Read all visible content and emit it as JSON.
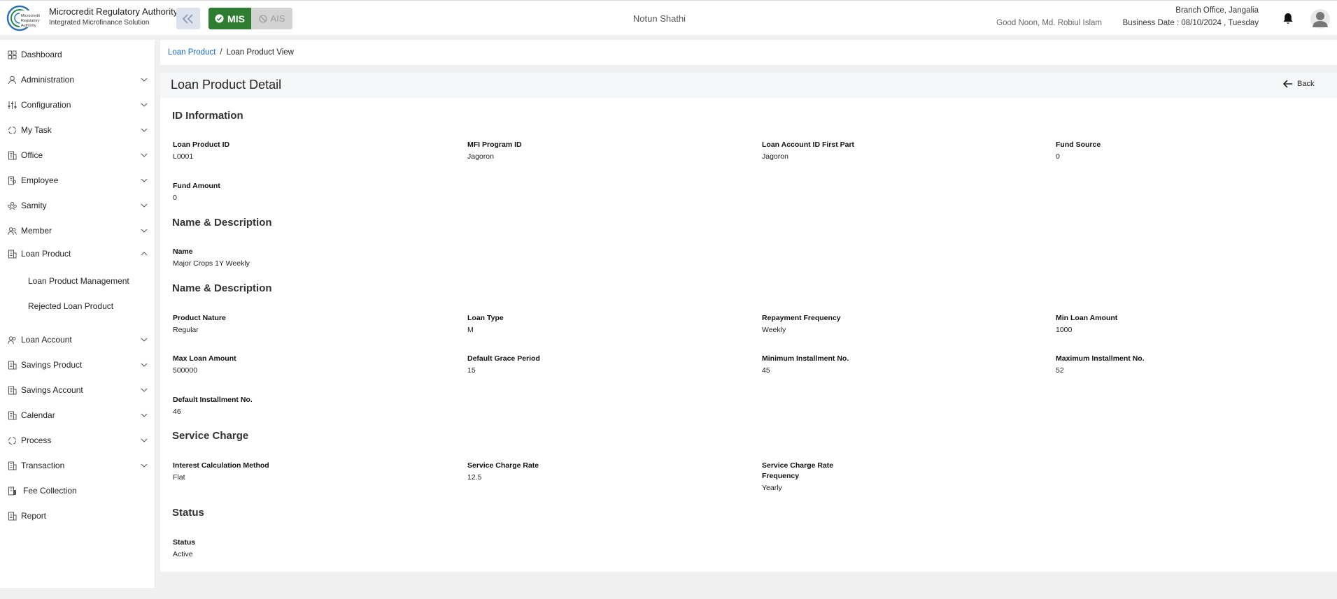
{
  "header": {
    "org_name": "Microcredit Regulatory Authority",
    "org_sub": "Integrated Microfinance Solution",
    "mode_mis": "MIS",
    "mode_ais": "AIS",
    "center_title": "Notun Shathi",
    "greeting": "Good Noon, Md. Robiul Islam",
    "branch": "Branch Office, Jangalia",
    "business_date": "Business Date : 08/10/2024 , Tuesday"
  },
  "sidebar": {
    "items": [
      {
        "label": "Dashboard",
        "icon": "dashboard-icon"
      },
      {
        "label": "Administration",
        "icon": "admin-icon"
      },
      {
        "label": "Configuration",
        "icon": "sliders-icon"
      },
      {
        "label": "My Task",
        "icon": "task-icon"
      },
      {
        "label": "Office",
        "icon": "office-icon"
      },
      {
        "label": "Employee",
        "icon": "employee-icon"
      },
      {
        "label": "Samity",
        "icon": "samity-icon"
      },
      {
        "label": "Member",
        "icon": "member-icon"
      },
      {
        "label": "Loan Product",
        "icon": "loan-product-icon"
      },
      {
        "label": "Loan Account",
        "icon": "loan-account-icon"
      },
      {
        "label": "Savings Product",
        "icon": "savings-product-icon"
      },
      {
        "label": "Savings Account",
        "icon": "savings-account-icon"
      },
      {
        "label": "Calendar",
        "icon": "calendar-icon"
      },
      {
        "label": "Process",
        "icon": "process-icon"
      },
      {
        "label": "Transaction",
        "icon": "transaction-icon"
      },
      {
        "label": "Fee Collection",
        "icon": "fee-icon"
      },
      {
        "label": "Report",
        "icon": "report-icon"
      }
    ],
    "sub_items": [
      "Loan Product Management",
      "Rejected Loan Product"
    ]
  },
  "breadcrumb": {
    "link": "Loan Product",
    "separator": "/",
    "current": "Loan Product View"
  },
  "page": {
    "title": "Loan Product Detail",
    "back_label": "Back"
  },
  "sections": {
    "id_info": {
      "title": "ID Information",
      "fields": [
        {
          "label": "Loan Product ID",
          "value": "L0001"
        },
        {
          "label": "MFI Program ID",
          "value": "Jagoron"
        },
        {
          "label": "Loan Account ID First Part",
          "value": "Jagoron"
        },
        {
          "label": "Fund Source",
          "value": "0"
        },
        {
          "label": "Fund Amount",
          "value": "0"
        }
      ]
    },
    "name_desc": {
      "title": "Name & Description",
      "fields": [
        {
          "label": "Name",
          "value": "Major Crops 1Y Weekly"
        }
      ]
    },
    "name_desc_2": {
      "title": "Name & Description",
      "fields": [
        {
          "label": "Product Nature",
          "value": "Regular"
        },
        {
          "label": "Loan Type",
          "value": "M"
        },
        {
          "label": "Repayment Frequency",
          "value": "Weekly"
        },
        {
          "label": "Min Loan Amount",
          "value": "1000"
        },
        {
          "label": "Max Loan Amount",
          "value": "500000"
        },
        {
          "label": "Default Grace Period",
          "value": "15"
        },
        {
          "label": "Minimum Installment No.",
          "value": "45"
        },
        {
          "label": "Maximum Installment No.",
          "value": "52"
        },
        {
          "label": "Default Installment No.",
          "value": "46"
        }
      ]
    },
    "service_charge": {
      "title": "Service Charge",
      "fields": [
        {
          "label": "Interest Calculation Method",
          "value": "Flat"
        },
        {
          "label": "Service Charge Rate",
          "value": "12.5"
        },
        {
          "label": "Service Charge Rate Frequency",
          "value": "Yearly"
        }
      ]
    },
    "status": {
      "title": "Status",
      "fields": [
        {
          "label": "Status",
          "value": "Active"
        }
      ]
    }
  }
}
